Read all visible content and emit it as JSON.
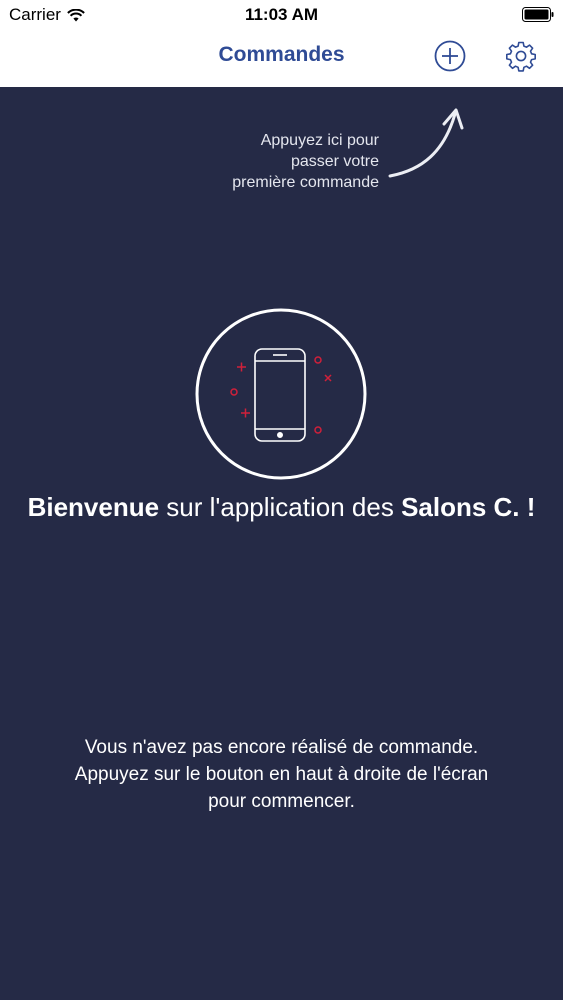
{
  "status_bar": {
    "carrier": "Carrier",
    "time": "11:03 AM"
  },
  "nav": {
    "title": "Commandes",
    "add_icon": "plus-circle-icon",
    "settings_icon": "gear-icon"
  },
  "hint": {
    "line1": "Appuyez ici pour",
    "line2": "passer votre",
    "line3": "première commande"
  },
  "welcome": {
    "part1": "Bienvenue",
    "part2": " sur l'application des ",
    "part3": "Salons C. !"
  },
  "empty_message": {
    "line1": "Vous n'avez pas encore réalisé de commande.",
    "line2": "Appuyez sur le bouton en haut à droite de l'écran",
    "line3": "pour commencer."
  },
  "colors": {
    "background": "#252a46",
    "header": "#ffffff",
    "brand_blue": "#2f4b95",
    "accent_red": "#d0203a"
  }
}
